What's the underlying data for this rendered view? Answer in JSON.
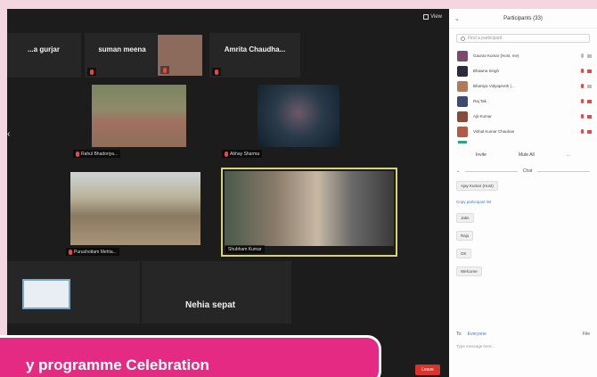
{
  "meeting": {
    "view_label": "View",
    "top_tiles": [
      {
        "name": "...a gurjar"
      },
      {
        "name": "suman meena"
      },
      {
        "name": ""
      },
      {
        "name": "Amrita Chaudha..."
      }
    ],
    "video_tiles": [
      {
        "label": "Rahul Bhadoriya..."
      },
      {
        "label": "Abhay Sharma"
      },
      {
        "label": "Purushottam Mehta..."
      },
      {
        "label": "Shubham Kumar"
      }
    ],
    "bottom_name": "Nehia sepat",
    "leave_label": "Leave"
  },
  "panel": {
    "title": "Participants (33)",
    "search_placeholder": "Find a participant",
    "participants": [
      {
        "name": "Gaurav Kumar (Host, me)",
        "avatar_color": "#7b4a6a"
      },
      {
        "name": "Bhawna Singh",
        "avatar_color": "#2b2b3a"
      },
      {
        "name": "Bhartiya Vidyapeeth (...",
        "avatar_color": "#b07b5a"
      },
      {
        "name": "Raj Tak",
        "avatar_color": "#3f4a72"
      },
      {
        "name": "Ajit Kumar",
        "avatar_color": "#8a4a3a"
      },
      {
        "name": "Vishal Kumar Chauhan",
        "avatar_color": "#b05a4a"
      }
    ],
    "buttons": [
      "Invite",
      "Mute All",
      "..."
    ],
    "chat_section": "Chat",
    "chips": [
      "Ajay Kumar (Host)"
    ],
    "link_text": "Copy participant list",
    "small_chips": [
      "Jatin",
      "Raju",
      "OK",
      "Welcome"
    ],
    "chat_to_label": "To:",
    "chat_to_value": "Everyone",
    "chat_file_label": "File",
    "chat_hint": "Type message here..."
  },
  "caption": {
    "text": "y programme Celebration"
  },
  "colors": {
    "banner": "#e52a83",
    "meeting_bg": "#1c1c1c",
    "leave": "#d9342b",
    "active_border": "#d8d27a"
  }
}
